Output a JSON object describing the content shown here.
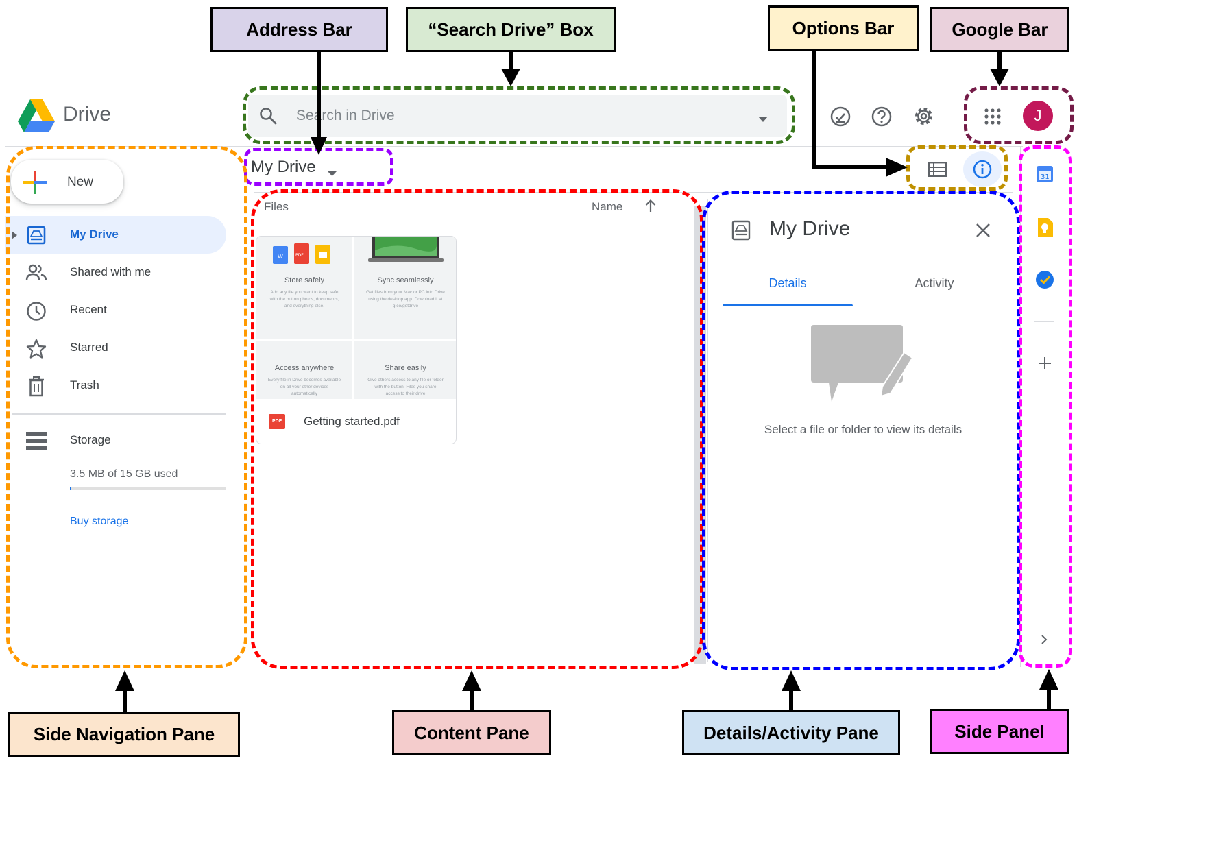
{
  "colors": {
    "address_bar": "#d9d3ea",
    "search_box": "#d8ead2",
    "options_bar": "#fff2cc",
    "google_bar": "#ead1dc",
    "side_nav": "#fce5cd",
    "content": "#f4cccc",
    "details": "#cfe2f3",
    "side_panel": "#ff80ff",
    "region_address": "#9900ff",
    "region_search": "#38761d",
    "region_options": "#bf9000",
    "region_google": "#741b47",
    "region_sidenav": "#ff9900",
    "region_content": "#ff0000",
    "region_details": "#0000ff",
    "region_sidepanel": "#ff00ff",
    "accent": "#1a73e8"
  },
  "labels": {
    "address_bar": "Address Bar",
    "search_box": "“Search Drive” Box",
    "options_bar": "Options Bar",
    "google_bar": "Google Bar",
    "side_nav": "Side Navigation Pane",
    "content": "Content Pane",
    "details": "Details/Activity Pane",
    "side_panel": "Side Panel"
  },
  "app": {
    "name": "Drive",
    "search_placeholder": "Search in Drive",
    "avatar_initial": "J"
  },
  "sidebar": {
    "new_label": "New",
    "items": [
      {
        "label": "My Drive",
        "icon": "my-drive-icon",
        "active": true
      },
      {
        "label": "Shared with me",
        "icon": "shared-icon",
        "active": false
      },
      {
        "label": "Recent",
        "icon": "clock-icon",
        "active": false
      },
      {
        "label": "Starred",
        "icon": "star-icon",
        "active": false
      },
      {
        "label": "Trash",
        "icon": "trash-icon",
        "active": false
      }
    ],
    "storage_label": "Storage",
    "storage_used": "3.5 MB of 15 GB used",
    "buy_storage": "Buy storage"
  },
  "main": {
    "breadcrumb": "My Drive",
    "files_header": "Files",
    "sort_label": "Name",
    "file": {
      "name": "Getting started.pdf",
      "pdf_badge": "PDF",
      "tiles": [
        {
          "title": "Store safely",
          "body": "Add any file you want to keep safe with the button photos, documents, and everything else."
        },
        {
          "title": "Sync seamlessly",
          "body": "Get files from your Mac or PC into Drive using the desktop app. Download it at g.co/getdrive"
        },
        {
          "title": "Access anywhere",
          "body": "Every file in Drive becomes available on all your other devices automatically"
        },
        {
          "title": "Share easily",
          "body": "Give others access to any file or folder with the button. Files you share access to their drive"
        }
      ]
    }
  },
  "details": {
    "title": "My Drive",
    "tab_details": "Details",
    "tab_activity": "Activity",
    "empty_message": "Select a file or folder to view its details"
  }
}
